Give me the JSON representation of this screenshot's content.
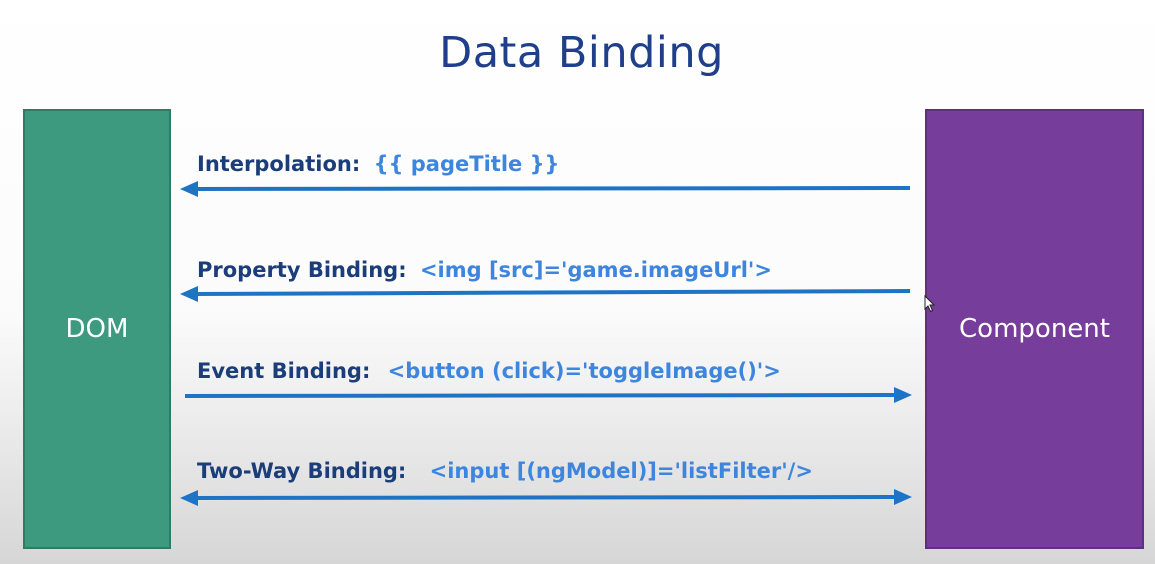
{
  "title": "Data Binding",
  "dom_box": {
    "label": "DOM"
  },
  "component_box": {
    "label": "Component"
  },
  "bindings": [
    {
      "name": "Interpolation:",
      "code": "{{ pageTitle }}",
      "direction": "component-to-dom"
    },
    {
      "name": "Property Binding:",
      "code": "<img [src]='game.imageUrl'>",
      "direction": "component-to-dom"
    },
    {
      "name": "Event Binding:",
      "code": "<button (click)='toggleImage()'>",
      "direction": "dom-to-component"
    },
    {
      "name": "Two-Way Binding:",
      "code": "<input [(ngModel)]='listFilter'/>",
      "direction": "both"
    }
  ],
  "colors": {
    "title": "#1f3f8a",
    "label_name": "#1b3d7a",
    "label_code": "#3e86dd",
    "arrow": "#1f73c4",
    "dom_box": "#3d9a7e",
    "component_box": "#763d9b"
  }
}
